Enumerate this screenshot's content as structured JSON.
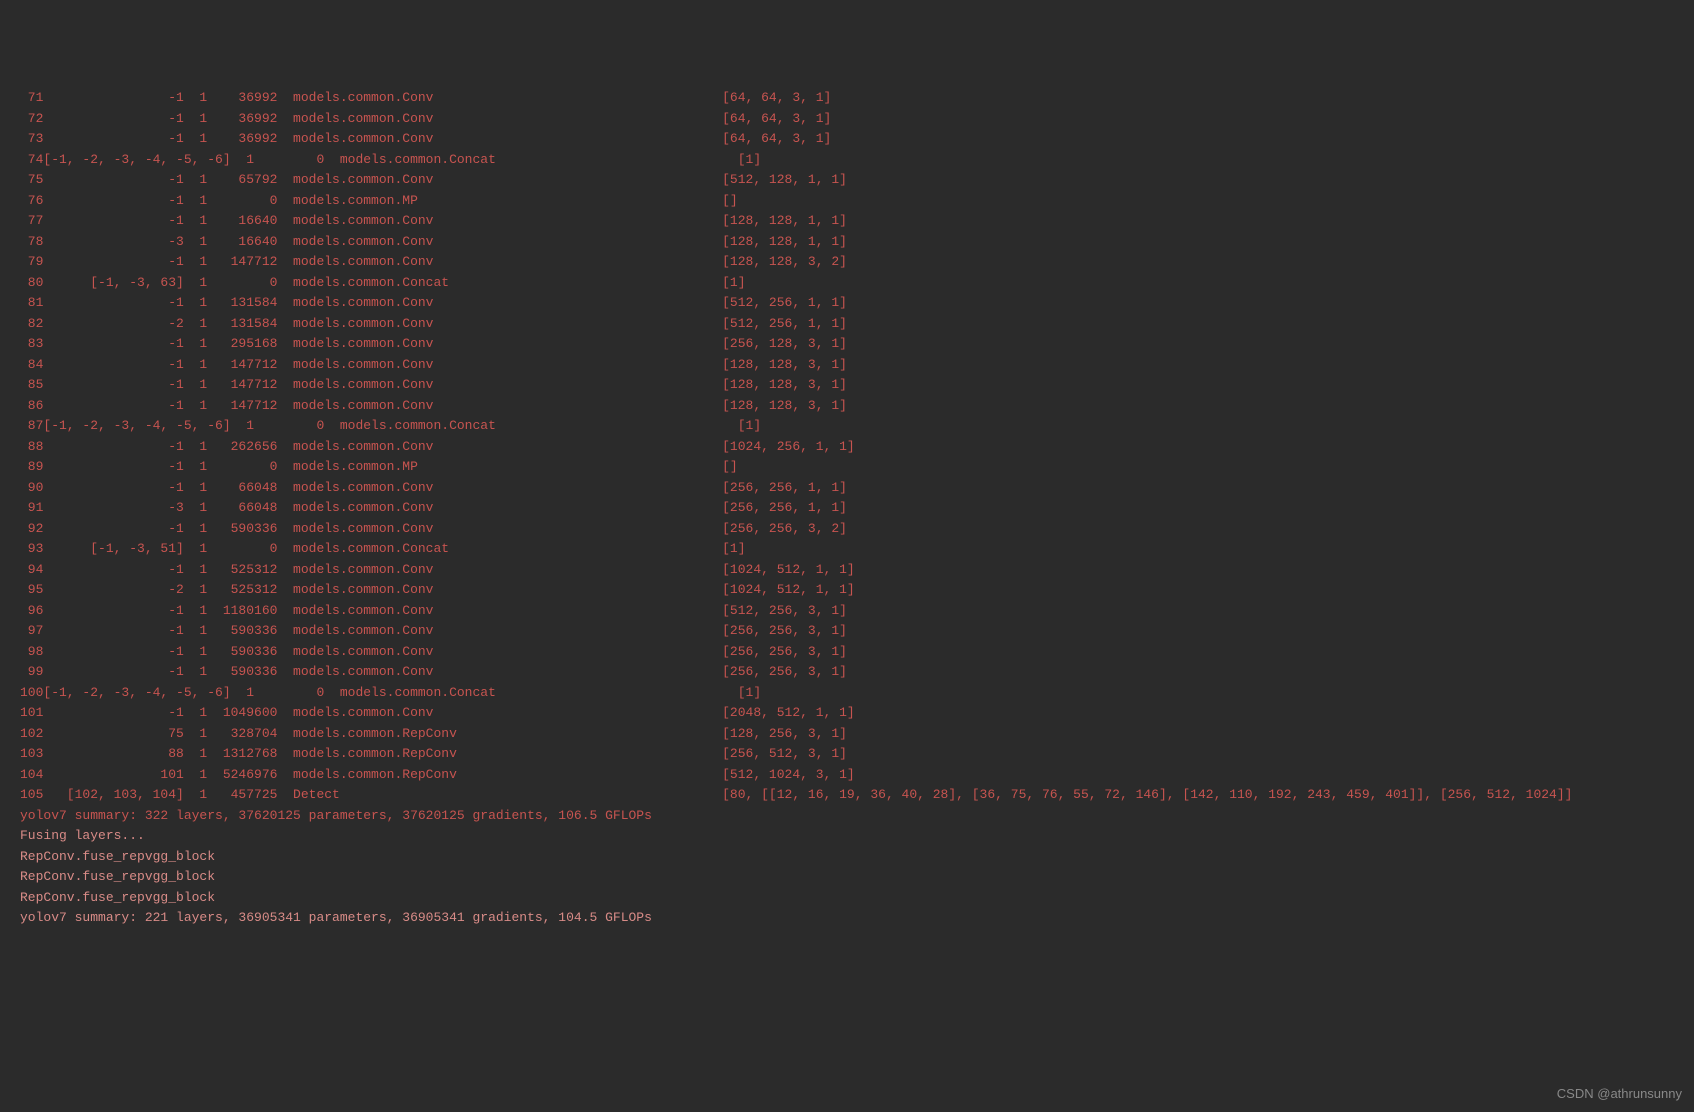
{
  "rows": [
    {
      "idx": " 71",
      "from": "                -1",
      "n": "  1",
      "params": "    36992",
      "module": "models.common.Conv",
      "args": "[64, 64, 3, 1]",
      "apad": "                  "
    },
    {
      "idx": " 72",
      "from": "                -1",
      "n": "  1",
      "params": "    36992",
      "module": "models.common.Conv",
      "args": "[64, 64, 3, 1]",
      "apad": "                  "
    },
    {
      "idx": " 73",
      "from": "                -1",
      "n": "  1",
      "params": "    36992",
      "module": "models.common.Conv",
      "args": "[64, 64, 3, 1]",
      "apad": "                  "
    },
    {
      "idx": " 74",
      "from": "[-1, -2, -3, -4, -5, -6]",
      "n": "  1",
      "params": "        0",
      "module": "models.common.Concat",
      "args": "[1]",
      "apad": "                ",
      "concat": true
    },
    {
      "idx": " 75",
      "from": "                -1",
      "n": "  1",
      "params": "    65792",
      "module": "models.common.Conv",
      "args": "[512, 128, 1, 1]",
      "apad": "                  "
    },
    {
      "idx": " 76",
      "from": "                -1",
      "n": "  1",
      "params": "        0",
      "module": "models.common.MP",
      "args": "[]",
      "apad": "                  "
    },
    {
      "idx": " 77",
      "from": "                -1",
      "n": "  1",
      "params": "    16640",
      "module": "models.common.Conv",
      "args": "[128, 128, 1, 1]",
      "apad": "                  "
    },
    {
      "idx": " 78",
      "from": "                -3",
      "n": "  1",
      "params": "    16640",
      "module": "models.common.Conv",
      "args": "[128, 128, 1, 1]",
      "apad": "                  "
    },
    {
      "idx": " 79",
      "from": "                -1",
      "n": "  1",
      "params": "   147712",
      "module": "models.common.Conv",
      "args": "[128, 128, 3, 2]",
      "apad": "                  "
    },
    {
      "idx": " 80",
      "from": "      [-1, -3, 63]",
      "n": "  1",
      "params": "        0",
      "module": "models.common.Concat",
      "args": "[1]",
      "apad": "                  "
    },
    {
      "idx": " 81",
      "from": "                -1",
      "n": "  1",
      "params": "   131584",
      "module": "models.common.Conv",
      "args": "[512, 256, 1, 1]",
      "apad": "                  "
    },
    {
      "idx": " 82",
      "from": "                -2",
      "n": "  1",
      "params": "   131584",
      "module": "models.common.Conv",
      "args": "[512, 256, 1, 1]",
      "apad": "                  "
    },
    {
      "idx": " 83",
      "from": "                -1",
      "n": "  1",
      "params": "   295168",
      "module": "models.common.Conv",
      "args": "[256, 128, 3, 1]",
      "apad": "                  "
    },
    {
      "idx": " 84",
      "from": "                -1",
      "n": "  1",
      "params": "   147712",
      "module": "models.common.Conv",
      "args": "[128, 128, 3, 1]",
      "apad": "                  "
    },
    {
      "idx": " 85",
      "from": "                -1",
      "n": "  1",
      "params": "   147712",
      "module": "models.common.Conv",
      "args": "[128, 128, 3, 1]",
      "apad": "                  "
    },
    {
      "idx": " 86",
      "from": "                -1",
      "n": "  1",
      "params": "   147712",
      "module": "models.common.Conv",
      "args": "[128, 128, 3, 1]",
      "apad": "                  "
    },
    {
      "idx": " 87",
      "from": "[-1, -2, -3, -4, -5, -6]",
      "n": "  1",
      "params": "        0",
      "module": "models.common.Concat",
      "args": "[1]",
      "apad": "                ",
      "concat": true
    },
    {
      "idx": " 88",
      "from": "                -1",
      "n": "  1",
      "params": "   262656",
      "module": "models.common.Conv",
      "args": "[1024, 256, 1, 1]",
      "apad": "                  "
    },
    {
      "idx": " 89",
      "from": "                -1",
      "n": "  1",
      "params": "        0",
      "module": "models.common.MP",
      "args": "[]",
      "apad": "                  "
    },
    {
      "idx": " 90",
      "from": "                -1",
      "n": "  1",
      "params": "    66048",
      "module": "models.common.Conv",
      "args": "[256, 256, 1, 1]",
      "apad": "                  "
    },
    {
      "idx": " 91",
      "from": "                -3",
      "n": "  1",
      "params": "    66048",
      "module": "models.common.Conv",
      "args": "[256, 256, 1, 1]",
      "apad": "                  "
    },
    {
      "idx": " 92",
      "from": "                -1",
      "n": "  1",
      "params": "   590336",
      "module": "models.common.Conv",
      "args": "[256, 256, 3, 2]",
      "apad": "                  "
    },
    {
      "idx": " 93",
      "from": "      [-1, -3, 51]",
      "n": "  1",
      "params": "        0",
      "module": "models.common.Concat",
      "args": "[1]",
      "apad": "                  "
    },
    {
      "idx": " 94",
      "from": "                -1",
      "n": "  1",
      "params": "   525312",
      "module": "models.common.Conv",
      "args": "[1024, 512, 1, 1]",
      "apad": "                  "
    },
    {
      "idx": " 95",
      "from": "                -2",
      "n": "  1",
      "params": "   525312",
      "module": "models.common.Conv",
      "args": "[1024, 512, 1, 1]",
      "apad": "                  "
    },
    {
      "idx": " 96",
      "from": "                -1",
      "n": "  1",
      "params": "  1180160",
      "module": "models.common.Conv",
      "args": "[512, 256, 3, 1]",
      "apad": "                  "
    },
    {
      "idx": " 97",
      "from": "                -1",
      "n": "  1",
      "params": "   590336",
      "module": "models.common.Conv",
      "args": "[256, 256, 3, 1]",
      "apad": "                  "
    },
    {
      "idx": " 98",
      "from": "                -1",
      "n": "  1",
      "params": "   590336",
      "module": "models.common.Conv",
      "args": "[256, 256, 3, 1]",
      "apad": "                  "
    },
    {
      "idx": " 99",
      "from": "                -1",
      "n": "  1",
      "params": "   590336",
      "module": "models.common.Conv",
      "args": "[256, 256, 3, 1]",
      "apad": "                  "
    },
    {
      "idx": "100",
      "from": "[-1, -2, -3, -4, -5, -6]",
      "n": "  1",
      "params": "        0",
      "module": "models.common.Concat",
      "args": "[1]",
      "apad": "                ",
      "concat": true
    },
    {
      "idx": "101",
      "from": "                -1",
      "n": "  1",
      "params": "  1049600",
      "module": "models.common.Conv",
      "args": "[2048, 512, 1, 1]",
      "apad": "                  "
    },
    {
      "idx": "102",
      "from": "                75",
      "n": "  1",
      "params": "   328704",
      "module": "models.common.RepConv",
      "args": "[128, 256, 3, 1]",
      "apad": "                  "
    },
    {
      "idx": "103",
      "from": "                88",
      "n": "  1",
      "params": "  1312768",
      "module": "models.common.RepConv",
      "args": "[256, 512, 3, 1]",
      "apad": "                  "
    },
    {
      "idx": "104",
      "from": "               101",
      "n": "  1",
      "params": "  5246976",
      "module": "models.common.RepConv",
      "args": "[512, 1024, 3, 1]",
      "apad": "                  "
    },
    {
      "idx": "105",
      "from": "   [102, 103, 104]",
      "n": "  1",
      "params": "   457725",
      "module": "Detect",
      "args": "[80, [[12, 16, 19, 36, 40, 28], [36, 75, 76, 55, 72, 146], [142, 110, 192, 243, 459, 401]], [256, 512, 1024]]",
      "apad": "                  "
    }
  ],
  "summary1": "yolov7 summary: 322 layers, 37620125 parameters, 37620125 gradients, 106.5 GFLOPs",
  "blank": "",
  "tail": [
    "Fusing layers... ",
    "RepConv.fuse_repvgg_block",
    "RepConv.fuse_repvgg_block",
    "RepConv.fuse_repvgg_block",
    "yolov7 summary: 221 layers, 36905341 parameters, 36905341 gradients, 104.5 GFLOPs"
  ],
  "watermark": "CSDN @athrunsunny"
}
